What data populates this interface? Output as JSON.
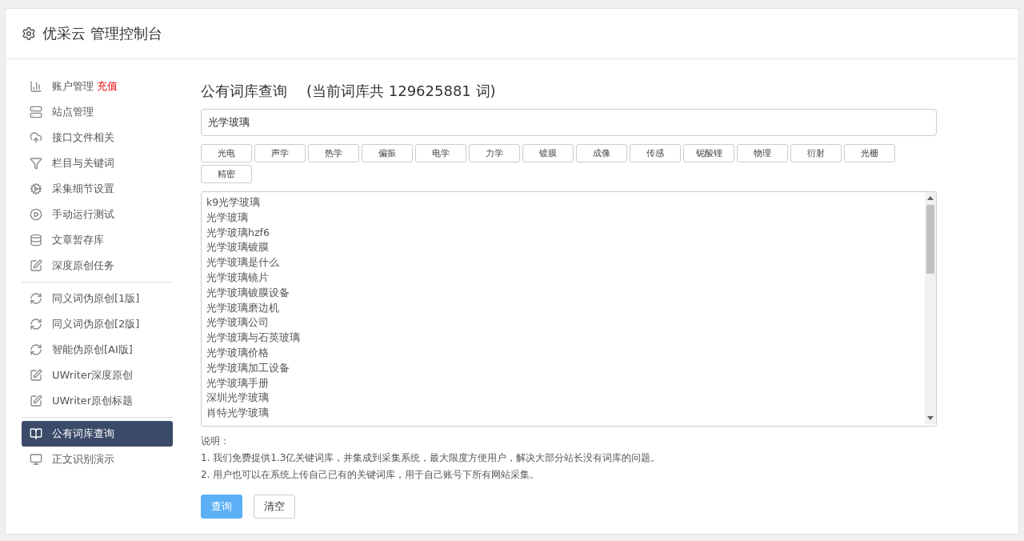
{
  "header": {
    "title": "优采云 管理控制台"
  },
  "sidebar": {
    "groups": [
      {
        "items": [
          {
            "kind": "chart",
            "label": "账户管理",
            "extra": "充值",
            "selected": false
          },
          {
            "kind": "server",
            "label": "站点管理",
            "selected": false
          },
          {
            "kind": "cloud",
            "label": "接口文件相关",
            "selected": false
          },
          {
            "kind": "filter",
            "label": "栏目与关键词",
            "selected": false
          },
          {
            "kind": "cogs",
            "label": "采集细节设置",
            "selected": false
          },
          {
            "kind": "play",
            "label": "手动运行测试",
            "selected": false
          },
          {
            "kind": "database",
            "label": "文章暂存库",
            "selected": false
          },
          {
            "kind": "edit",
            "label": "深度原创任务",
            "selected": false
          }
        ]
      },
      {
        "items": [
          {
            "kind": "refresh",
            "label": "同义词伪原创[1版]",
            "selected": false
          },
          {
            "kind": "refresh",
            "label": "同义词伪原创[2版]",
            "selected": false
          },
          {
            "kind": "refresh",
            "label": "智能伪原创[AI版]",
            "selected": false
          },
          {
            "kind": "edit",
            "label": "UWriter深度原创",
            "selected": false
          },
          {
            "kind": "edit",
            "label": "UWriter原创标题",
            "selected": false
          }
        ]
      },
      {
        "items": [
          {
            "kind": "book",
            "label": "公有词库查询",
            "selected": true
          },
          {
            "kind": "monitor",
            "label": "正文识别演示",
            "selected": false
          }
        ]
      }
    ]
  },
  "main": {
    "title": "公有词库查询",
    "count_note": "(当前词库共 129625881 词)",
    "search": {
      "value": "光学玻璃"
    },
    "tags": [
      "光电",
      "声学",
      "热学",
      "偏振",
      "电学",
      "力学",
      "镀膜",
      "成像",
      "传感",
      "铌酸锂",
      "物理",
      "衍射",
      "光栅",
      "精密"
    ],
    "results": [
      "k9光学玻璃",
      "光学玻璃",
      "光学玻璃hzf6",
      "光学玻璃镀膜",
      "光学玻璃是什么",
      "光学玻璃镜片",
      "光学玻璃镀膜设备",
      "光学玻璃磨边机",
      "光学玻璃公司",
      "光学玻璃与石英玻璃",
      "光学玻璃价格",
      "光学玻璃加工设备",
      "光学玻璃手册",
      "深圳光学玻璃",
      "肖特光学玻璃"
    ],
    "notes_title": "说明：",
    "notes": [
      "1. 我们免费提供1.3亿关键词库，并集成到采集系统，最大限度方便用户，解决大部分站长没有词库的问题。",
      "2. 用户也可以在系统上传自己已有的关键词库，用于自己账号下所有网站采集。"
    ],
    "buttons": [
      {
        "kind": "primary",
        "label": "查询"
      },
      {
        "kind": "default",
        "label": "清空"
      }
    ]
  }
}
